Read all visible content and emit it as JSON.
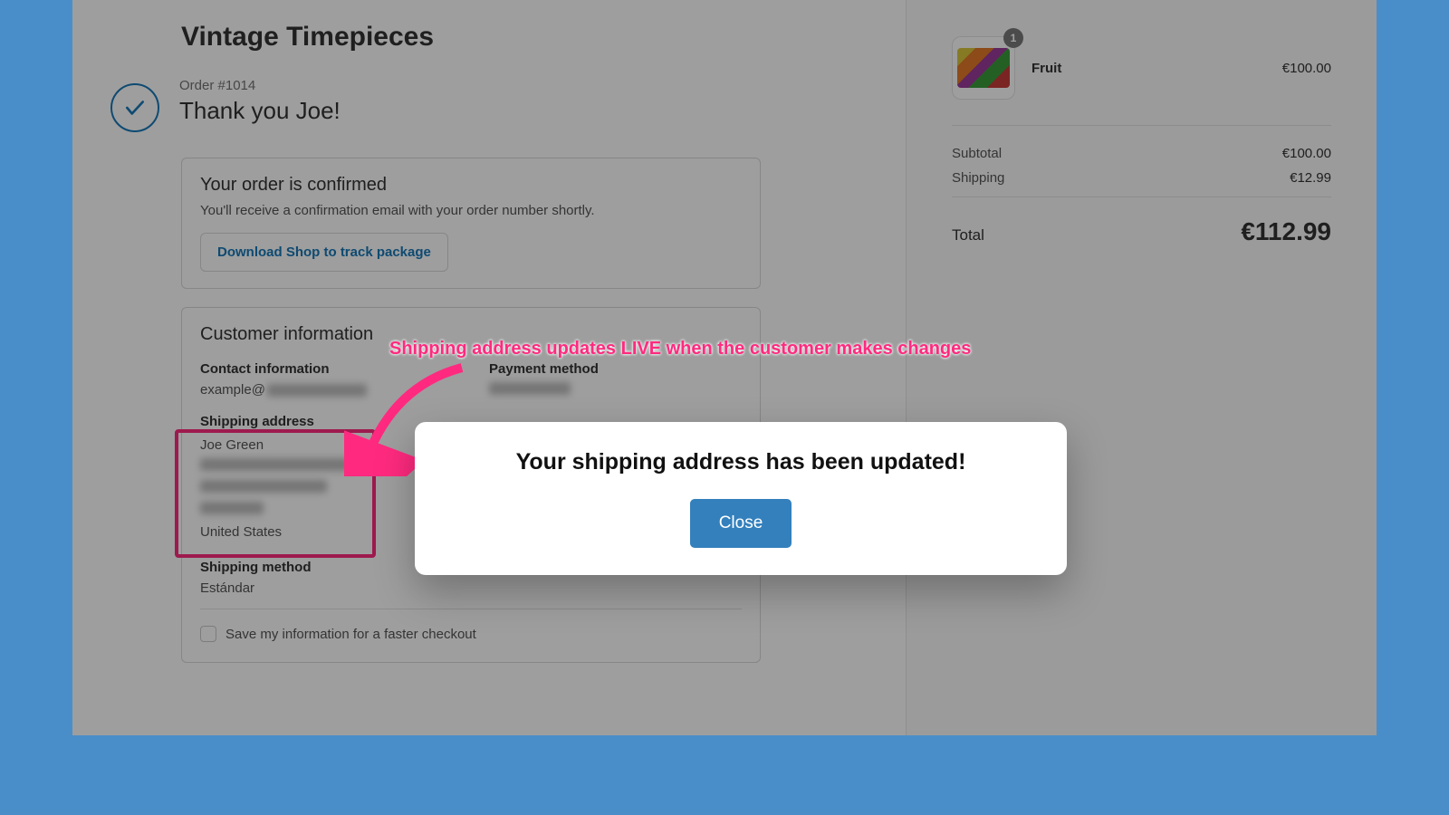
{
  "shop": {
    "name": "Vintage Timepieces"
  },
  "order": {
    "number": "Order #1014",
    "thank_you": "Thank you Joe!"
  },
  "confirm_card": {
    "title": "Your order is confirmed",
    "sub": "You'll receive a confirmation email with your order number shortly.",
    "download_btn": "Download Shop to track package"
  },
  "customer": {
    "title": "Customer information",
    "contact_label": "Contact information",
    "contact_value": "example@",
    "payment_label": "Payment method",
    "shipping_addr_label": "Shipping address",
    "address": {
      "name": "Joe Green",
      "country": "United States"
    },
    "shipping_method_label": "Shipping method",
    "shipping_method_value": "Estándar",
    "save_checkbox": "Save my information for a faster checkout"
  },
  "annotation": {
    "text": "Shipping address updates LIVE when the customer makes changes"
  },
  "cart": {
    "item": {
      "name": "Fruit",
      "price": "€100.00",
      "qty": "1"
    },
    "subtotal_label": "Subtotal",
    "subtotal_value": "€100.00",
    "shipping_label": "Shipping",
    "shipping_value": "€12.99",
    "total_label": "Total",
    "total_value": "€112.99"
  },
  "modal": {
    "title": "Your shipping address has been updated!",
    "close": "Close"
  }
}
